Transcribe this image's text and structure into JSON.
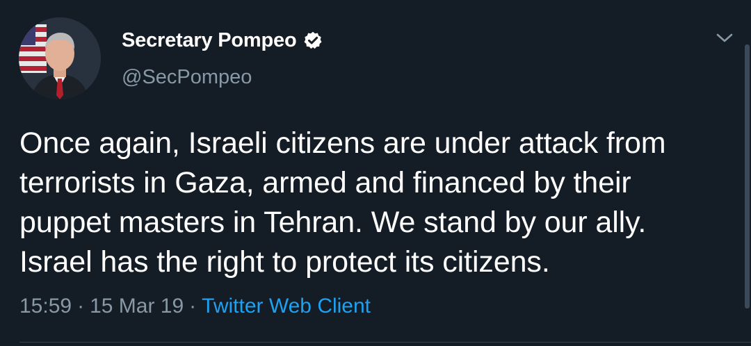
{
  "author": {
    "display_name": "Secretary Pompeo",
    "handle": "@SecPompeo",
    "verified": true
  },
  "tweet": {
    "text_lines": [
      "Once again, Israeli citizens are under attack from",
      "terrorists in Gaza, armed and financed by their",
      "puppet masters in Tehran. We stand by our ally.",
      "Israel has the right to protect its citizens."
    ]
  },
  "meta": {
    "time": "15:59",
    "separator": "·",
    "date": "15 Mar 19",
    "source": "Twitter Web Client"
  },
  "icons": {
    "verified": "verified-badge-icon",
    "menu": "chevron-down-icon"
  },
  "colors": {
    "background": "#141d26",
    "text_primary": "#ffffff",
    "text_secondary": "#8899a6",
    "link": "#1da1f2"
  }
}
